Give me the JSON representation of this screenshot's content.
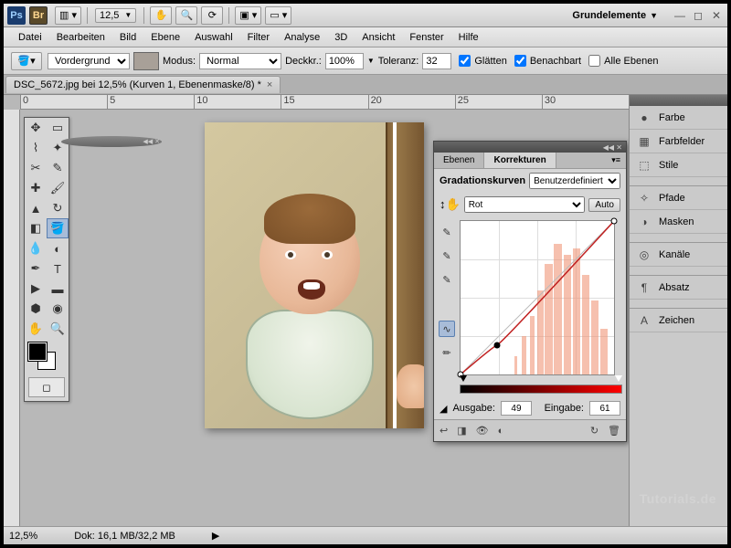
{
  "titlebar": {
    "zoom": "12,5",
    "workspace": "Grundelemente"
  },
  "menu": [
    "Datei",
    "Bearbeiten",
    "Bild",
    "Ebene",
    "Auswahl",
    "Filter",
    "Analyse",
    "3D",
    "Ansicht",
    "Fenster",
    "Hilfe"
  ],
  "options": {
    "fill": "Vordergrund",
    "mode_label": "Modus:",
    "mode": "Normal",
    "opacity_label": "Deckkr.:",
    "opacity": "100%",
    "tolerance_label": "Toleranz:",
    "tolerance": "32",
    "antialias": "Glätten",
    "contiguous": "Benachbart",
    "all_layers": "Alle Ebenen"
  },
  "doc": {
    "title": "DSC_5672.jpg bei 12,5% (Kurven 1, Ebenenmaske/8) *"
  },
  "ruler_ticks": [
    "0",
    "5",
    "10",
    "15",
    "20",
    "25",
    "30"
  ],
  "rightpanels": [
    {
      "icon": "●",
      "label": "Farbe"
    },
    {
      "icon": "▦",
      "label": "Farbfelder"
    },
    {
      "icon": "⬚",
      "label": "Stile"
    },
    {
      "sep": true
    },
    {
      "icon": "✧",
      "label": "Pfade"
    },
    {
      "icon": "◑",
      "label": "Masken"
    },
    {
      "sep": true
    },
    {
      "icon": "◎",
      "label": "Kanäle"
    },
    {
      "sep": true
    },
    {
      "icon": "¶",
      "label": "Absatz"
    },
    {
      "sep": true
    },
    {
      "icon": "A",
      "label": "Zeichen"
    }
  ],
  "curves": {
    "tab1": "Ebenen",
    "tab2": "Korrekturen",
    "title": "Gradationskurven",
    "preset": "Benutzerdefiniert",
    "channel": "Rot",
    "auto": "Auto",
    "output_label": "Ausgabe:",
    "output": "49",
    "input_label": "Eingabe:",
    "input": "61"
  },
  "status": {
    "zoom": "12,5%",
    "docinfo": "Dok: 16,1 MB/32,2 MB"
  },
  "watermark": "Tutorials.de"
}
